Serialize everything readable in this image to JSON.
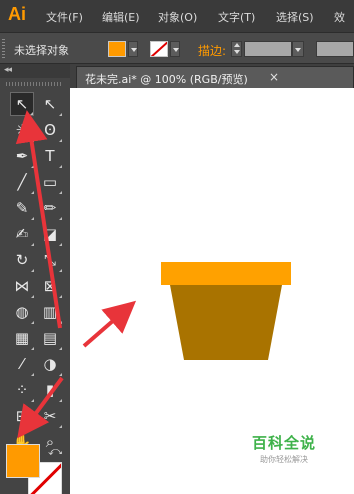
{
  "menubar": {
    "app_logo": "Ai",
    "items": [
      "文件(F)",
      "编辑(E)",
      "对象(O)",
      "文字(T)",
      "选择(S)",
      "效"
    ]
  },
  "controlbar": {
    "selection_status": "未选择对象",
    "fill_color": "#ff9a00",
    "stroke_label": "描边:",
    "stroke_field_value": ""
  },
  "document": {
    "tab_title": "花未完.ai* @ 100% (RGB/预览)",
    "close_glyph": "×"
  },
  "artwork": {
    "pot_rim_color": "#ffa100",
    "pot_body_color": "#a97300"
  },
  "watermark": {
    "title": "百科全说",
    "subtitle": "助你轻松解决"
  },
  "colors": {
    "accent": "#ff9a00",
    "annotation_arrow": "#e8343a",
    "ui_dark": "#444444"
  },
  "tools": [
    {
      "name": "selection-tool-icon",
      "glyph": "↖"
    },
    {
      "name": "direct-selection-tool-icon",
      "glyph": "↖"
    },
    {
      "name": "magic-wand-tool-icon",
      "glyph": "✳"
    },
    {
      "name": "lasso-tool-icon",
      "glyph": "ʘ"
    },
    {
      "name": "pen-tool-icon",
      "glyph": "✒"
    },
    {
      "name": "type-tool-icon",
      "glyph": "T"
    },
    {
      "name": "line-segment-tool-icon",
      "glyph": "╱"
    },
    {
      "name": "rectangle-tool-icon",
      "glyph": "▭"
    },
    {
      "name": "paintbrush-tool-icon",
      "glyph": "✎"
    },
    {
      "name": "pencil-tool-icon",
      "glyph": "✏"
    },
    {
      "name": "blob-brush-tool-icon",
      "glyph": "✍"
    },
    {
      "name": "eraser-tool-icon",
      "glyph": "◪"
    },
    {
      "name": "rotate-tool-icon",
      "glyph": "↻"
    },
    {
      "name": "scale-tool-icon",
      "glyph": "⤡"
    },
    {
      "name": "width-tool-icon",
      "glyph": "⋈"
    },
    {
      "name": "free-transform-tool-icon",
      "glyph": "⊠"
    },
    {
      "name": "shape-builder-tool-icon",
      "glyph": "◍"
    },
    {
      "name": "perspective-grid-tool-icon",
      "glyph": "▥"
    },
    {
      "name": "mesh-tool-icon",
      "glyph": "▦"
    },
    {
      "name": "gradient-tool-icon",
      "glyph": "▤"
    },
    {
      "name": "eyedropper-tool-icon",
      "glyph": "⁄"
    },
    {
      "name": "blend-tool-icon",
      "glyph": "◑"
    },
    {
      "name": "symbol-sprayer-tool-icon",
      "glyph": "⁘"
    },
    {
      "name": "column-graph-tool-icon",
      "glyph": "▮"
    },
    {
      "name": "artboard-tool-icon",
      "glyph": "⊞"
    },
    {
      "name": "slice-tool-icon",
      "glyph": "✂"
    },
    {
      "name": "hand-tool-icon",
      "glyph": "✋"
    },
    {
      "name": "zoom-tool-icon",
      "glyph": "⌕"
    }
  ],
  "toolbox": {
    "collapse_glyph": "◂◂",
    "swap_glyph": "⤺"
  }
}
